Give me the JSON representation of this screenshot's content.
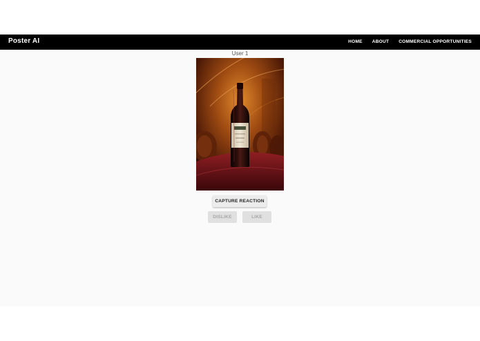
{
  "app": {
    "title": "Poster AI"
  },
  "nav": {
    "items": [
      {
        "label": "HOME"
      },
      {
        "label": "ABOUT"
      },
      {
        "label": "COMMERCIAL OPPORTUNITIES"
      }
    ]
  },
  "main": {
    "user_label": "User 1",
    "poster_subject": "wine-bottle-poster",
    "capture_button": "CAPTURE REACTION",
    "dislike_button": "DISLIKE",
    "like_button": "LIKE"
  },
  "colors": {
    "appbar_bg": "#000000",
    "appbar_text": "#ffffff",
    "page_bg": "#fafafa",
    "button_bg": "#ececec",
    "disabled_bg": "#e0e0e0",
    "disabled_text": "#a6a6a6"
  }
}
